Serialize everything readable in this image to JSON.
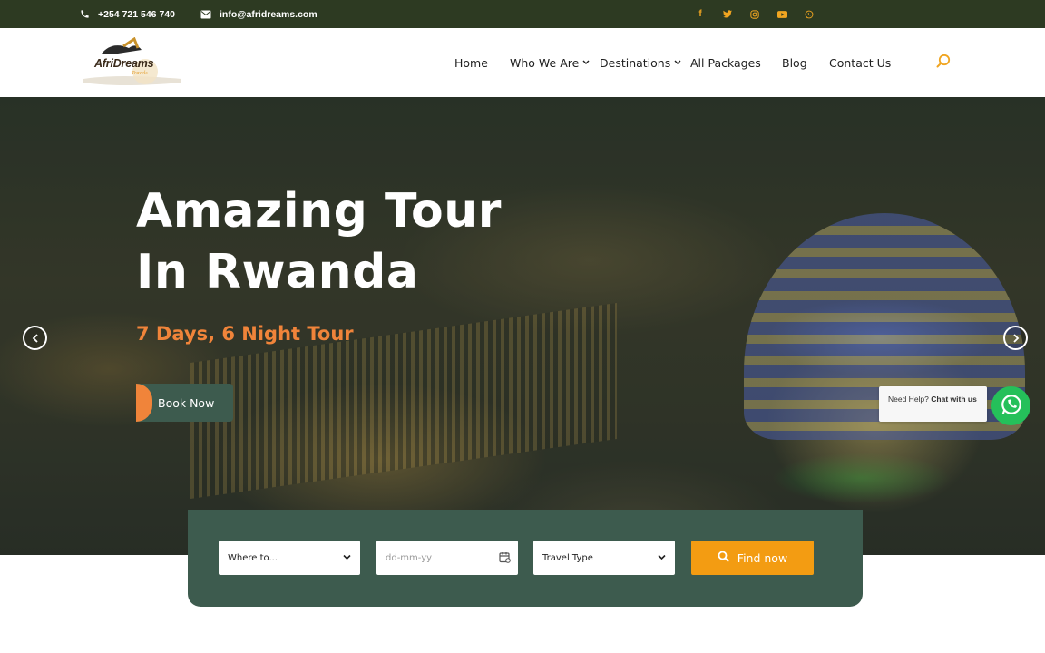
{
  "topbar": {
    "phone": "+254 721 546 740",
    "email": "info@afridreams.com",
    "socials": [
      {
        "icon": "facebook-icon",
        "glyph": "f"
      },
      {
        "icon": "twitter-icon",
        "glyph": ""
      },
      {
        "icon": "instagram-icon",
        "glyph": ""
      },
      {
        "icon": "youtube-icon",
        "glyph": ""
      },
      {
        "icon": "whatsapp-icon",
        "glyph": ""
      }
    ],
    "accent_color": "#f0a521",
    "background_color": "#2d3a22"
  },
  "logo": {
    "name": "AfriDreams",
    "tagline": "Travels"
  },
  "nav": {
    "items": [
      {
        "label": "Home",
        "dropdown": false
      },
      {
        "label": "Who We Are",
        "dropdown": true
      },
      {
        "label": "Destinations",
        "dropdown": true
      },
      {
        "label": "All Packages",
        "dropdown": false
      },
      {
        "label": "Blog",
        "dropdown": false
      },
      {
        "label": "Contact Us",
        "dropdown": false
      }
    ],
    "search_icon": "search-icon"
  },
  "hero": {
    "title_line1": "Amazing Tour",
    "title_line2": "In Rwanda",
    "subtitle": "7 Days, 6 Night Tour",
    "cta": "Book Now",
    "subtitle_color": "#f0843a"
  },
  "chat": {
    "prefix": "Need Help?",
    "link": "Chat with us"
  },
  "search_form": {
    "where_value": "Where to...",
    "date_placeholder": "dd-mm-yy",
    "type_value": "Travel Type",
    "button_label": "Find now",
    "panel_color": "#3d5b4e",
    "button_color": "#f39c12"
  }
}
